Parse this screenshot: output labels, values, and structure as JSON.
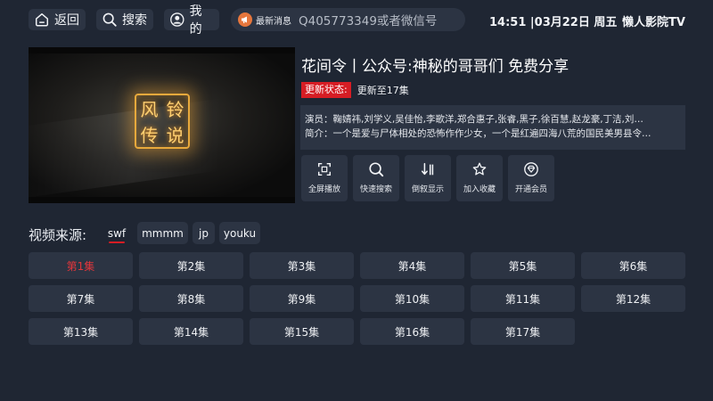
{
  "nav": {
    "back_label": "返回",
    "search_label": "搜索",
    "mine_label": "我的"
  },
  "news": {
    "label": "最新消息",
    "text": "Q405773349或者微信号"
  },
  "header": {
    "clock": "14:51 |03月22日 周五",
    "app_name": "懒人影院TV"
  },
  "video": {
    "logo_chars": [
      "风",
      "铃",
      "传",
      "说"
    ]
  },
  "show": {
    "title": "花间令丨公众号:神秘的哥哥们 免费分享",
    "status_label": "更新状态:",
    "status_value": "更新至17集",
    "cast": "演员：鞠婧祎,刘学义,吴佳怡,李歌洋,郑合惠子,张睿,黑子,徐百慧,赵龙豪,丁洁,刘…",
    "summary": "简介：一个是爱与尸体相处的恐怖作作少女，一个是红遍四海八荒的国民美男县令…"
  },
  "actions": [
    {
      "label": "全屏播放",
      "icon": "fullscreen-icon"
    },
    {
      "label": "快速搜索",
      "icon": "search-icon"
    },
    {
      "label": "倒叙显示",
      "icon": "sort-icon"
    },
    {
      "label": "加入收藏",
      "icon": "star-icon"
    },
    {
      "label": "开通会员",
      "icon": "vip-diamond-icon"
    }
  ],
  "sources": {
    "label": "视频来源:",
    "items": [
      "swf",
      "mmmm",
      "jp",
      "youku"
    ],
    "selected": "swf"
  },
  "episodes": [
    "第1集",
    "第2集",
    "第3集",
    "第4集",
    "第5集",
    "第6集",
    "第7集",
    "第8集",
    "第9集",
    "第10集",
    "第11集",
    "第12集",
    "第13集",
    "第14集",
    "第15集",
    "第16集",
    "第17集"
  ],
  "selected_episode": "第1集",
  "colors": {
    "background": "#1f2633",
    "panel": "#2c3443",
    "accent_red": "#d61d24",
    "logo_gold": "#e8a93c"
  }
}
